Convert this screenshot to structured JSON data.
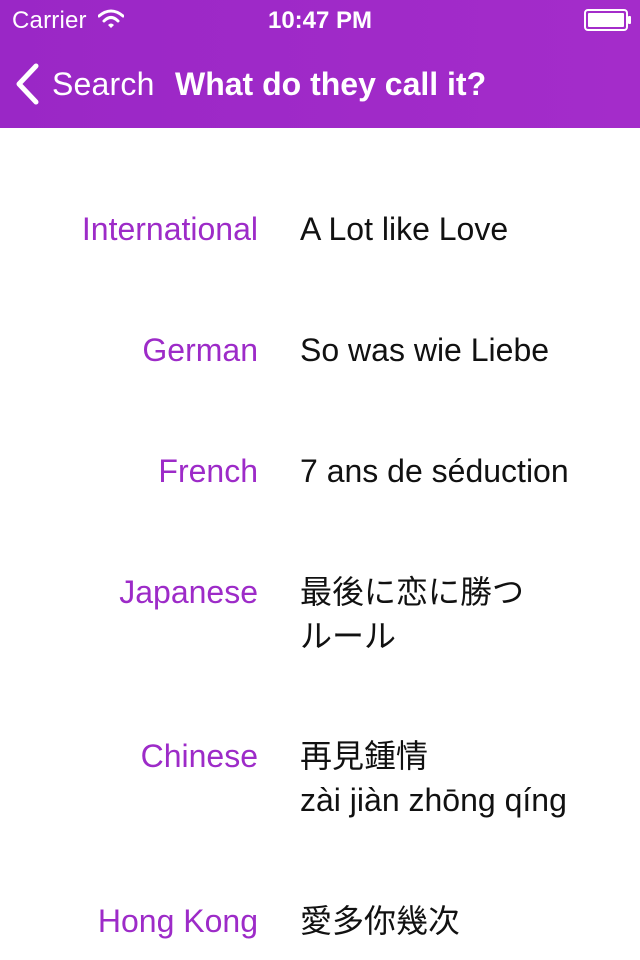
{
  "status_bar": {
    "carrier": "Carrier",
    "time": "10:47 PM"
  },
  "nav": {
    "back_label": "Search",
    "title": "What do they call it?"
  },
  "colors": {
    "header_purple": "#a42cca",
    "label_purple": "#9d2bc8",
    "value_text": "#111111",
    "background": "#ffffff"
  },
  "titles": [
    {
      "region": "International",
      "lines": [
        "A Lot like Love"
      ]
    },
    {
      "region": "German",
      "lines": [
        "So was wie Liebe"
      ]
    },
    {
      "region": "French",
      "lines": [
        "7 ans de séduction"
      ]
    },
    {
      "region": "Japanese",
      "lines": [
        "最後に恋に勝つ",
        "ルール"
      ]
    },
    {
      "region": "Chinese",
      "lines": [
        "再見鍾情",
        "zài jiàn zhōng qíng"
      ]
    },
    {
      "region": "Hong Kong",
      "lines": [
        "愛多你幾次"
      ]
    }
  ]
}
